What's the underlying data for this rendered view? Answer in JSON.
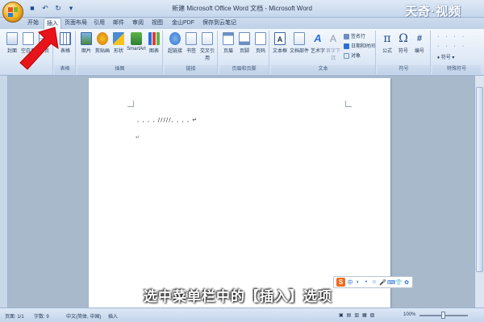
{
  "window": {
    "title": "新建 Microsoft Office Word 文档 - Microsoft Word",
    "brand": "天奇·视频"
  },
  "tabs": [
    {
      "label": "开始",
      "active": false
    },
    {
      "label": "插入",
      "active": true
    },
    {
      "label": "页面布局",
      "active": false
    },
    {
      "label": "引用",
      "active": false
    },
    {
      "label": "邮件",
      "active": false
    },
    {
      "label": "审阅",
      "active": false
    },
    {
      "label": "视图",
      "active": false
    },
    {
      "label": "金山PDF",
      "active": false
    },
    {
      "label": "保存到云笔记",
      "active": false
    }
  ],
  "ribbon": {
    "groups": [
      {
        "label": "",
        "buttons": [
          "封面",
          "空白页",
          "分页"
        ]
      },
      {
        "label": "表格",
        "buttons": [
          "表格"
        ]
      },
      {
        "label": "插图",
        "buttons": [
          "图片",
          "剪贴画",
          "形状",
          "SmartArt",
          "图表"
        ]
      },
      {
        "label": "链接",
        "buttons": [
          "超链接",
          "书签",
          "交叉引用"
        ]
      },
      {
        "label": "页眉和页脚",
        "buttons": [
          "页眉",
          "页脚",
          "页码"
        ]
      },
      {
        "label": "文本",
        "buttons": [
          "文本框",
          "文档部件",
          "艺术字",
          "首字下沉"
        ],
        "small": [
          "签名行",
          "日期和时间",
          "对象"
        ]
      },
      {
        "label": "符号",
        "buttons": [
          "公式",
          "符号",
          "编号"
        ]
      },
      {
        "label": "特殊符号",
        "buttons": [
          "符号"
        ]
      }
    ]
  },
  "document": {
    "text": ", , , , /////, , , , ↵",
    "para_mark": "↵"
  },
  "caption": "选中菜单栏中的【插入】选项",
  "ime": {
    "logo": "S",
    "glyphs": [
      "中",
      "◐",
      "•",
      "☺",
      "🎤",
      "⌨",
      "👕",
      "✿"
    ]
  },
  "status": {
    "page": "页面: 1/1",
    "words": "字数: 9",
    "language": "中文(简体, 中国)",
    "mode": "插入",
    "zoom": "100%"
  },
  "colors": {
    "arrow": "#e8141c",
    "accent": "#2a6fd6"
  }
}
